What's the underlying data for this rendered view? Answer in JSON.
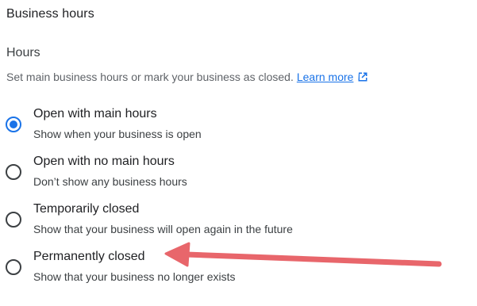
{
  "header": {
    "title": "Business hours"
  },
  "hours": {
    "heading": "Hours",
    "description": "Set main business hours or mark your business as closed.",
    "learn_more": "Learn more"
  },
  "options": [
    {
      "label": "Open with main hours",
      "sub": "Show when your business is open",
      "checked": true
    },
    {
      "label": "Open with no main hours",
      "sub": "Don’t show any business hours",
      "checked": false
    },
    {
      "label": "Temporarily closed",
      "sub": "Show that your business will open again in the future",
      "checked": false
    },
    {
      "label": "Permanently closed",
      "sub": "Show that your business no longer exists",
      "checked": false
    }
  ],
  "colors": {
    "accent": "#1a73e8",
    "annotation_arrow": "#e8666b"
  },
  "icons": {
    "learn_more": "external-link-icon"
  }
}
